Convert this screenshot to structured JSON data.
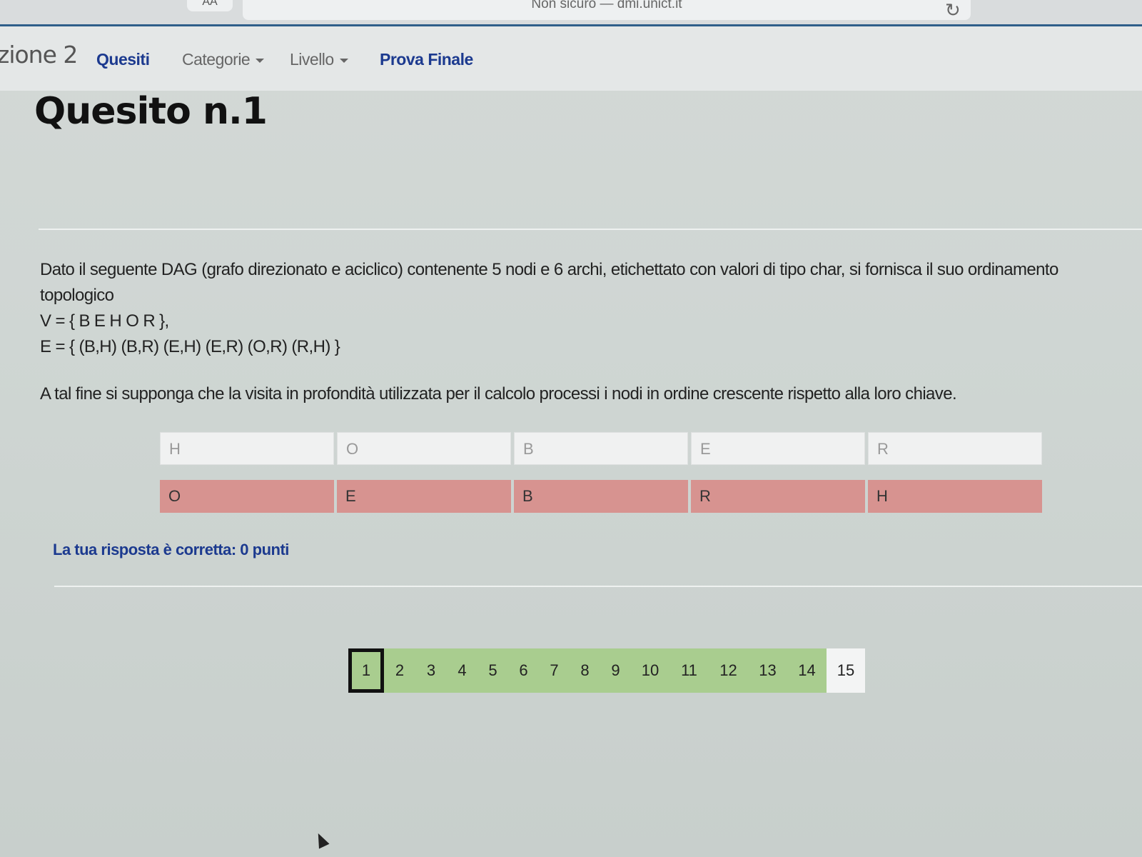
{
  "browser": {
    "text_size_button": "AA",
    "address": "Non sicuro — dmi.unict.it",
    "reload_icon": "reload-icon"
  },
  "nav": {
    "brand": "zione 2",
    "quesiti": "Quesiti",
    "categorie": "Categorie",
    "livello": "Livello",
    "prova_finale": "Prova Finale"
  },
  "question": {
    "title": "Quesito n.1",
    "text": "Dato il seguente DAG (grafo direzionato e aciclico) contenente 5 nodi e 6 archi, etichettato con valori di tipo char, si fornisca il suo ordinamento topologico",
    "vertices": "V = { B E H O R },",
    "edges": "E = { (B,H) (B,R) (E,H) (E,R) (O,R) (R,H) }",
    "note": "A tal fine si supponga che la visita in profondità utilizzata per il calcolo processi i nodi in ordine crescente rispetto alla loro chiave."
  },
  "answer": {
    "user": [
      "H",
      "O",
      "B",
      "E",
      "R"
    ],
    "solution": [
      "O",
      "E",
      "B",
      "R",
      "H"
    ],
    "feedback": "La tua risposta è corretta: 0 punti"
  },
  "pagination": {
    "pages": [
      "1",
      "2",
      "3",
      "4",
      "5",
      "6",
      "7",
      "8",
      "9",
      "10",
      "11",
      "12",
      "13",
      "14",
      "15"
    ],
    "current": "1",
    "answered_color": "#a9cd8f",
    "unanswered_color": "#f3f4f4"
  }
}
